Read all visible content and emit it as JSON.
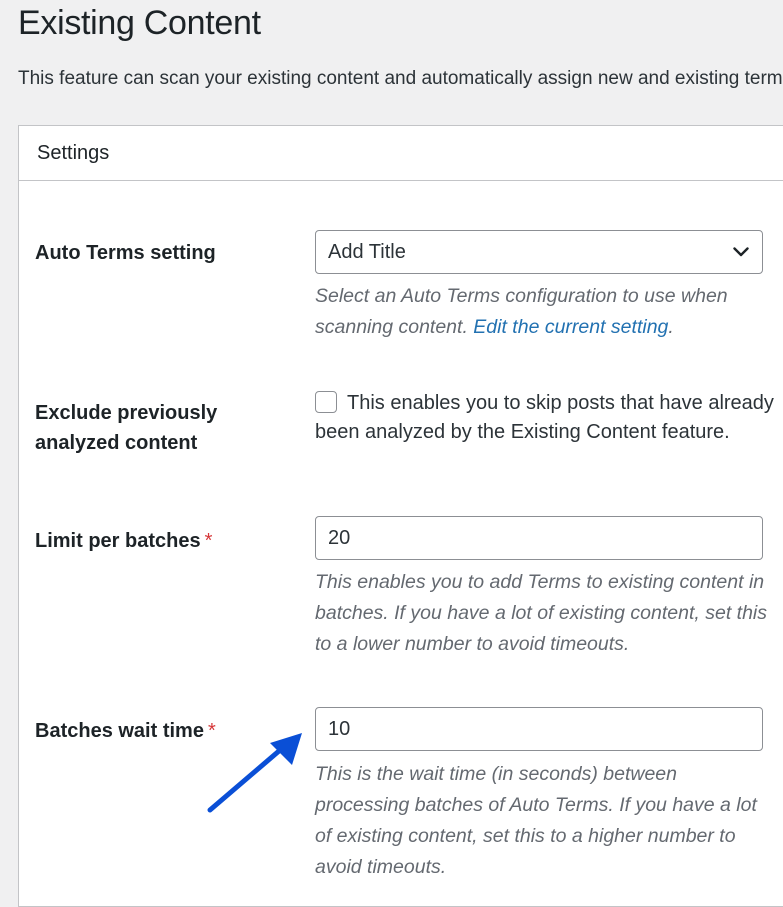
{
  "page": {
    "title": "Existing Content",
    "intro": "This feature can scan your existing content and automatically assign new and existing terms"
  },
  "panel": {
    "title": "Settings"
  },
  "auto_terms": {
    "label": "Auto Terms setting",
    "selected": "Add Title",
    "desc_prefix": "Select an Auto Terms configuration to use when scanning content. ",
    "desc_link": "Edit the current setting",
    "desc_suffix": "."
  },
  "exclude": {
    "label_line1": "Exclude previously",
    "label_line2": "analyzed content",
    "checked": false,
    "text": "This enables you to skip posts that have already been analyzed by the Existing Content feature."
  },
  "limit": {
    "label": "Limit per batches",
    "required_mark": "*",
    "value": "20",
    "desc": "This enables you to add Terms to existing content in batches. If you have a lot of existing content, set this to a lower number to avoid timeouts."
  },
  "wait": {
    "label": "Batches wait time",
    "required_mark": "*",
    "value": "10",
    "desc": "This is the wait time (in seconds) between processing batches of Auto Terms. If you have a lot of existing content, set this to a higher number to avoid timeouts."
  },
  "icons": {
    "select_chevron": "chevron-down-icon",
    "annotation_arrow": "arrow-icon"
  },
  "colors": {
    "link": "#2271b1",
    "required": "#d63638",
    "annotation_arrow": "#0a4fd6"
  }
}
